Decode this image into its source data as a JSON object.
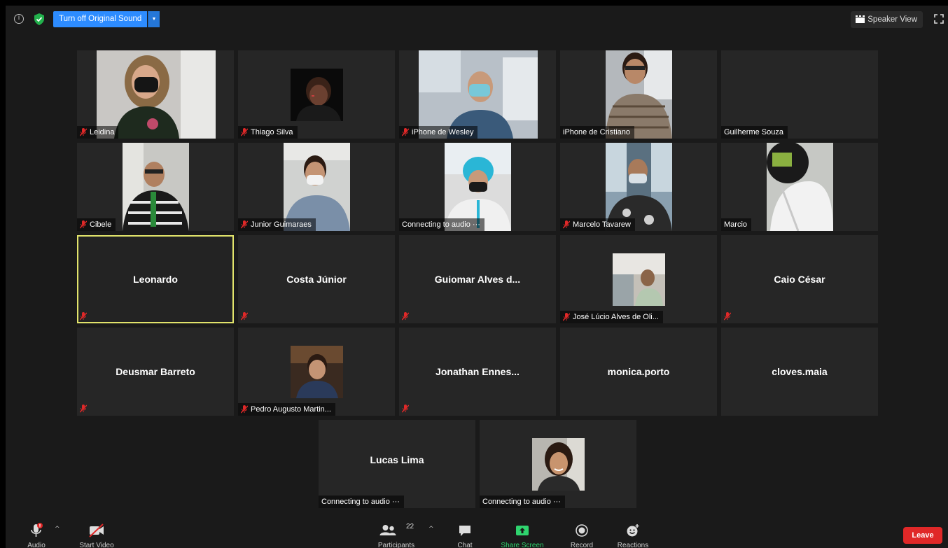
{
  "topbar": {
    "original_sound_label": "Turn off Original Sound",
    "speaker_view_label": "Speaker View"
  },
  "tiles": [
    {
      "name": "Leidina",
      "muted": true,
      "video": true
    },
    {
      "name": "Thiago Silva",
      "muted": true,
      "video": true
    },
    {
      "name": "iPhone de Wesley",
      "muted": true,
      "video": true
    },
    {
      "name": "iPhone de Cristiano",
      "muted": false,
      "video": true
    },
    {
      "name": "Guilherme Souza",
      "muted": false,
      "video": false
    },
    {
      "name": "Cibele",
      "muted": true,
      "video": true
    },
    {
      "name": "Junior Guimaraes",
      "muted": true,
      "video": true
    },
    {
      "name": "Connecting to audio ···",
      "muted": false,
      "video": true
    },
    {
      "name": "Marcelo Tavarew",
      "muted": true,
      "video": true
    },
    {
      "name": "Marcio",
      "muted": false,
      "video": true
    },
    {
      "name": "Leonardo",
      "muted": true,
      "video": false
    },
    {
      "name": "Costa Júnior",
      "muted": true,
      "video": false
    },
    {
      "name": "Guiomar Alves d...",
      "muted": true,
      "video": false
    },
    {
      "name": "José Lúcio Alves de Oli...",
      "muted": true,
      "video": true
    },
    {
      "name": "Caio César",
      "muted": true,
      "video": false
    },
    {
      "name": "Deusmar Barreto",
      "muted": true,
      "video": false
    },
    {
      "name": "Pedro Augusto Martin...",
      "muted": true,
      "video": true
    },
    {
      "name": "Jonathan  Ennes...",
      "muted": true,
      "video": false
    },
    {
      "name": "monica.porto",
      "muted": false,
      "video": false
    },
    {
      "name": "cloves.maia",
      "muted": false,
      "video": false
    },
    {
      "name": "Lucas Lima",
      "status": "Connecting to audio ···",
      "video": false
    },
    {
      "name": "",
      "status": "Connecting to audio ···",
      "video": true
    }
  ],
  "toolbar": {
    "audio_label": "Audio",
    "video_label": "Start Video",
    "participants_label": "Participants",
    "participants_count": "22",
    "chat_label": "Chat",
    "share_label": "Share Screen",
    "record_label": "Record",
    "reactions_label": "Reactions",
    "leave_label": "Leave"
  },
  "colors": {
    "accent_blue": "#2d8cff",
    "active_speaker": "#e1e36b",
    "mute_red": "#e02828",
    "share_green": "#2fd46e"
  }
}
